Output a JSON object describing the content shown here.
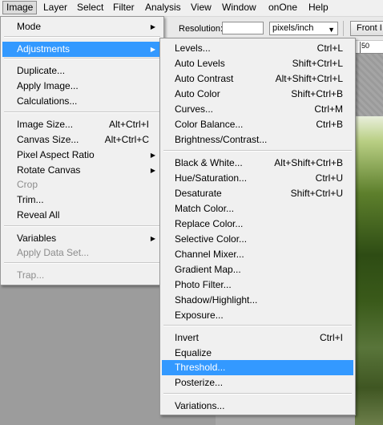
{
  "menubar": {
    "items": [
      "Image",
      "Layer",
      "Select",
      "Filter",
      "Analysis",
      "View",
      "Window",
      "onOne",
      "Help"
    ],
    "active": "Image"
  },
  "options": {
    "resolution_label": "Resolution:",
    "resolution_value": "",
    "units_value": "pixels/inch",
    "front_button": "Front I"
  },
  "ruler": {
    "label": "50"
  },
  "image_menu": {
    "items": [
      {
        "label": "Mode",
        "shortcut": "",
        "submenu": true,
        "disabled": false
      },
      {
        "label": "Adjustments",
        "shortcut": "",
        "submenu": true,
        "disabled": false,
        "highlighted": true
      },
      {
        "label": "Duplicate...",
        "shortcut": "",
        "submenu": false,
        "disabled": false
      },
      {
        "label": "Apply Image...",
        "shortcut": "",
        "submenu": false,
        "disabled": false
      },
      {
        "label": "Calculations...",
        "shortcut": "",
        "submenu": false,
        "disabled": false
      },
      {
        "label": "Image Size...",
        "shortcut": "Alt+Ctrl+I",
        "submenu": false,
        "disabled": false
      },
      {
        "label": "Canvas Size...",
        "shortcut": "Alt+Ctrl+C",
        "submenu": false,
        "disabled": false
      },
      {
        "label": "Pixel Aspect Ratio",
        "shortcut": "",
        "submenu": true,
        "disabled": false
      },
      {
        "label": "Rotate Canvas",
        "shortcut": "",
        "submenu": true,
        "disabled": false
      },
      {
        "label": "Crop",
        "shortcut": "",
        "submenu": false,
        "disabled": true
      },
      {
        "label": "Trim...",
        "shortcut": "",
        "submenu": false,
        "disabled": false
      },
      {
        "label": "Reveal All",
        "shortcut": "",
        "submenu": false,
        "disabled": false
      },
      {
        "label": "Variables",
        "shortcut": "",
        "submenu": true,
        "disabled": false
      },
      {
        "label": "Apply Data Set...",
        "shortcut": "",
        "submenu": false,
        "disabled": true
      },
      {
        "label": "Trap...",
        "shortcut": "",
        "submenu": false,
        "disabled": true
      }
    ]
  },
  "adjustments_menu": {
    "items": [
      {
        "label": "Levels...",
        "shortcut": "Ctrl+L"
      },
      {
        "label": "Auto Levels",
        "shortcut": "Shift+Ctrl+L"
      },
      {
        "label": "Auto Contrast",
        "shortcut": "Alt+Shift+Ctrl+L"
      },
      {
        "label": "Auto Color",
        "shortcut": "Shift+Ctrl+B"
      },
      {
        "label": "Curves...",
        "shortcut": "Ctrl+M"
      },
      {
        "label": "Color Balance...",
        "shortcut": "Ctrl+B"
      },
      {
        "label": "Brightness/Contrast...",
        "shortcut": ""
      },
      {
        "label": "Black & White...",
        "shortcut": "Alt+Shift+Ctrl+B"
      },
      {
        "label": "Hue/Saturation...",
        "shortcut": "Ctrl+U"
      },
      {
        "label": "Desaturate",
        "shortcut": "Shift+Ctrl+U"
      },
      {
        "label": "Match Color...",
        "shortcut": ""
      },
      {
        "label": "Replace Color...",
        "shortcut": ""
      },
      {
        "label": "Selective Color...",
        "shortcut": ""
      },
      {
        "label": "Channel Mixer...",
        "shortcut": ""
      },
      {
        "label": "Gradient Map...",
        "shortcut": ""
      },
      {
        "label": "Photo Filter...",
        "shortcut": ""
      },
      {
        "label": "Shadow/Highlight...",
        "shortcut": ""
      },
      {
        "label": "Exposure...",
        "shortcut": ""
      },
      {
        "label": "Invert",
        "shortcut": "Ctrl+I"
      },
      {
        "label": "Equalize",
        "shortcut": ""
      },
      {
        "label": "Threshold...",
        "shortcut": "",
        "highlighted": true
      },
      {
        "label": "Posterize...",
        "shortcut": ""
      },
      {
        "label": "Variations...",
        "shortcut": ""
      }
    ]
  },
  "colors": {
    "highlight": "#3399ff",
    "menu_bg": "#f0f0f0",
    "disabled_text": "#8c8c8c"
  }
}
